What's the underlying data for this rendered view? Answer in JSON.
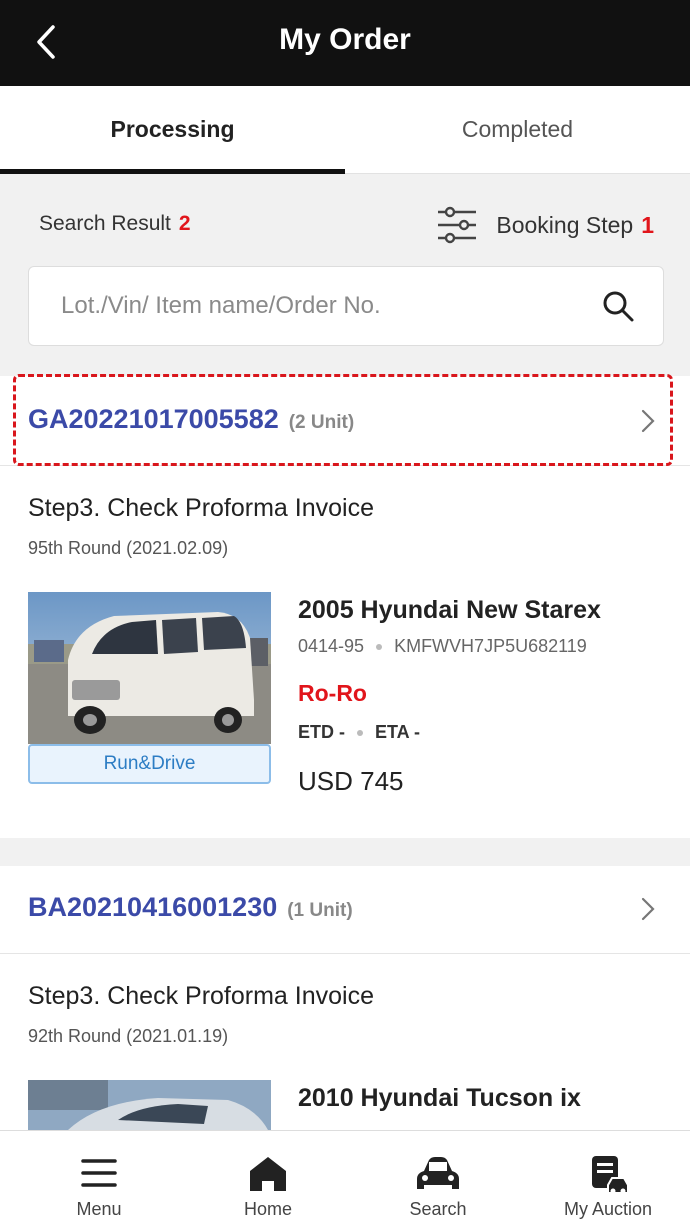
{
  "header": {
    "title": "My Order",
    "back_icon": "chevron-left-icon"
  },
  "tabs": [
    {
      "label": "Processing",
      "active": true
    },
    {
      "label": "Completed",
      "active": false
    }
  ],
  "summary": {
    "search_result_label": "Search Result",
    "search_result_count": "2",
    "booking_step_label": "Booking Step",
    "booking_step_count": "1",
    "filter_icon": "filter-sliders-icon"
  },
  "search": {
    "placeholder": "Lot./Vin/ Item name/Order No.",
    "icon": "search-icon"
  },
  "orders": [
    {
      "order_no": "GA20221017005582",
      "units": "(2 Unit)",
      "step": "Step3. Check Proforma Invoice",
      "round": "95th Round (2021.02.09)",
      "car": {
        "title": "2005 Hyundai New Starex",
        "lot": "0414-95",
        "vin": "KMFWVH7JP5U682119",
        "shipping": "Ro-Ro",
        "etd": "ETD -",
        "eta": "ETA -",
        "price": "USD 745",
        "badge": "Run&Drive"
      }
    },
    {
      "order_no": "BA20210416001230",
      "units": "(1 Unit)",
      "step": "Step3. Check Proforma Invoice",
      "round": "92th Round (2021.01.19)",
      "car": {
        "title": "2010 Hyundai Tucson ix"
      }
    }
  ],
  "bottom_nav": [
    {
      "label": "Menu",
      "icon": "menu-icon"
    },
    {
      "label": "Home",
      "icon": "home-icon"
    },
    {
      "label": "Search",
      "icon": "car-search-icon"
    },
    {
      "label": "My Auction",
      "icon": "my-auction-icon"
    }
  ],
  "colors": {
    "accent_blue": "#3b4aa8",
    "red": "#e1151b",
    "header_bg": "#111111",
    "badge_blue": "#2d7dc4"
  }
}
